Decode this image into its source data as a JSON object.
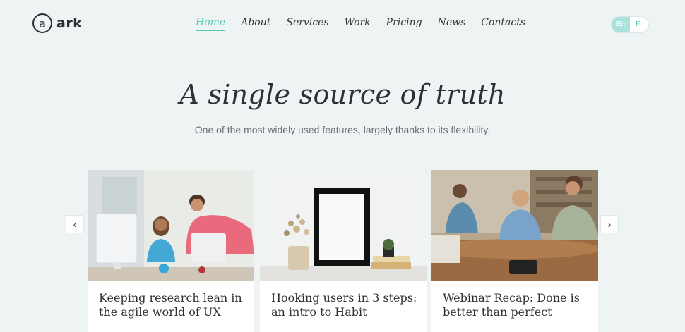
{
  "brand": {
    "logo_letter": "a",
    "name": "ark"
  },
  "nav": [
    {
      "label": "Home",
      "active": true
    },
    {
      "label": "About"
    },
    {
      "label": "Services"
    },
    {
      "label": "Work"
    },
    {
      "label": "Pricing"
    },
    {
      "label": "News"
    },
    {
      "label": "Contacts"
    }
  ],
  "lang": {
    "en": "En",
    "fr": "Fr",
    "active": "En"
  },
  "hero": {
    "title": "A single source of truth",
    "subtitle": "One of the most widely used features, largely thanks to its flexibility."
  },
  "carousel": {
    "prev_icon": "chevron-left-icon",
    "next_icon": "chevron-right-icon",
    "cards": [
      {
        "title": "Keeping research lean in the agile world of UX"
      },
      {
        "title": "Hooking users in 3 steps: an intro to Habit"
      },
      {
        "title": "Webinar Recap: Done is better than perfect"
      }
    ]
  },
  "colors": {
    "accent": "#53c7b9",
    "background": "#eef3f3",
    "text": "#2d3035"
  }
}
